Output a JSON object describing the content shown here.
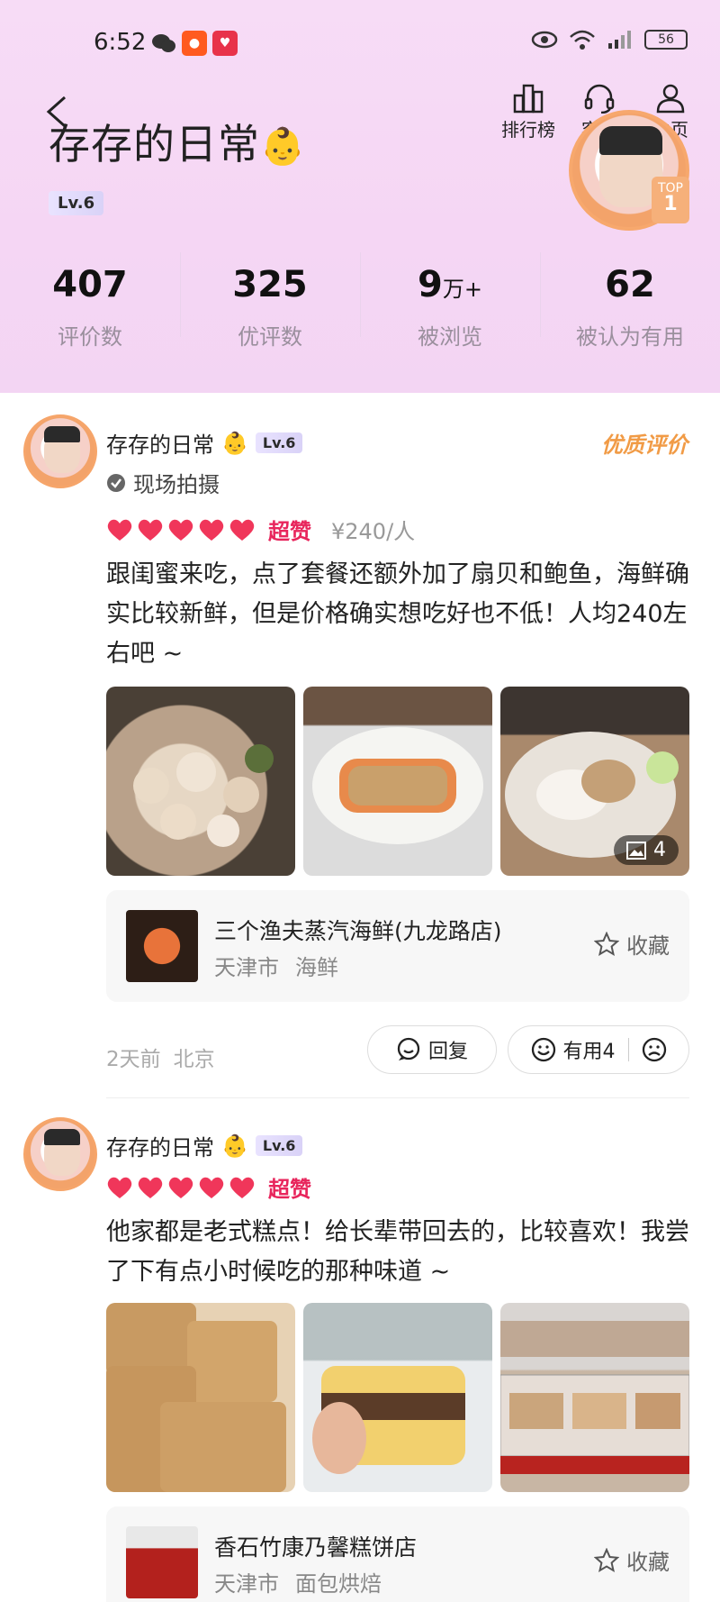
{
  "status": {
    "time": "6:52",
    "battery": "56",
    "network": "4G"
  },
  "header": {
    "title": "存存的日常",
    "title_emoji": "👶",
    "level": "Lv.6",
    "nav": [
      {
        "label": "排行榜",
        "icon": "ranking-icon"
      },
      {
        "label": "客服",
        "icon": "headset-icon"
      },
      {
        "label": "主页",
        "icon": "person-icon"
      }
    ],
    "top_badge": {
      "line1": "TOP",
      "line2": "1"
    },
    "stats": [
      {
        "value": "407",
        "unit": "",
        "label": "评价数"
      },
      {
        "value": "325",
        "unit": "",
        "label": "优评数"
      },
      {
        "value": "9",
        "unit": "万+",
        "label": "被浏览"
      },
      {
        "value": "62",
        "unit": "",
        "label": "被认为有用"
      }
    ]
  },
  "reviews": [
    {
      "author": "存存的日常",
      "emoji": "👶",
      "level": "Lv.6",
      "quality_tag": "优质评价",
      "photo_tag": "现场拍摄",
      "rating_text": "超赞",
      "price": "¥240/人",
      "text": "跟闺蜜来吃，点了套餐还额外加了扇贝和鲍鱼，海鲜确实比较新鲜，但是价格确实想吃好也不低！人均240左右吧 ~",
      "photo_count": "4",
      "shop": {
        "name": "三个渔夫蒸汽海鲜(九龙路店)",
        "city": "天津市",
        "category": "海鲜",
        "fav_label": "收藏"
      },
      "time": "2天前",
      "location": "北京",
      "reply_label": "回复",
      "useful_label": "有用4"
    },
    {
      "author": "存存的日常",
      "emoji": "👶",
      "level": "Lv.6",
      "rating_text": "超赞",
      "text": "他家都是老式糕点！给长辈带回去的，比较喜欢！我尝了下有点小时候吃的那种味道 ~",
      "shop": {
        "name": "香石竹康乃馨糕饼店",
        "city": "天津市",
        "category": "面包烘焙",
        "fav_label": "收藏"
      }
    }
  ],
  "colors": {
    "accent": "#e8255c",
    "quality": "#f19b46",
    "header_bg": "#f6d8f5"
  }
}
